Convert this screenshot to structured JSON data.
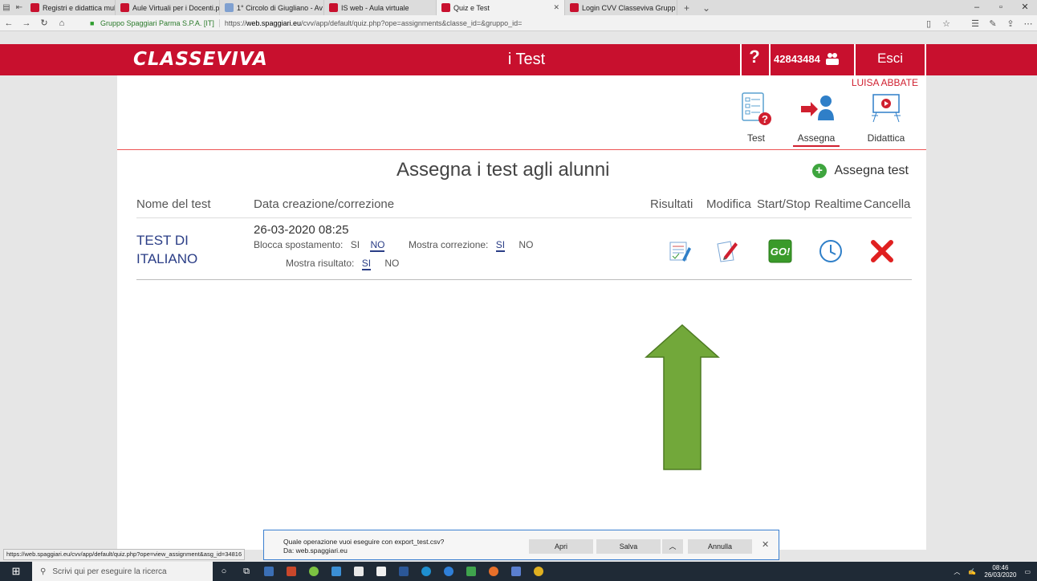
{
  "browser": {
    "tabs": [
      {
        "label": "Registri e didattica multime",
        "color": "#c8102e",
        "active": false
      },
      {
        "label": "Aule Virtuali per i Docenti.p",
        "color": "#c8102e",
        "active": false
      },
      {
        "label": "1° Circolo di Giugliano - Av",
        "color": "#7fa0d0",
        "active": false
      },
      {
        "label": "IS web - Aula virtuale",
        "color": "#c8102e",
        "active": false
      },
      {
        "label": "Quiz e Test",
        "color": "#c8102e",
        "active": true
      },
      {
        "label": "Login CVV Classeviva Grupp",
        "color": "#c8102e",
        "active": false
      }
    ],
    "address": {
      "site_name": "Gruppo Spaggiari Parma S.P.A. [IT]",
      "url_prefix": "https://",
      "url_host": "web.spaggiari.eu",
      "url_path": "/cvv/app/default/quiz.php?ope=assignments&classe_id=&gruppo_id="
    },
    "status_url": "https://web.spaggiari.eu/cvv/app/default/quiz.php?ope=view_assignment&asg_id=34816"
  },
  "header": {
    "logo": "CLASSEVIVA",
    "title": "i Test",
    "help": "?",
    "user_code": "42843484",
    "logout": "Esci",
    "user_name": "LUISA ABBATE"
  },
  "nav": {
    "items": [
      {
        "label": "Test",
        "icon": "test-checklist-icon",
        "active": false
      },
      {
        "label": "Assegna",
        "icon": "assign-user-icon",
        "active": true
      },
      {
        "label": "Didattica",
        "icon": "presentation-board-icon",
        "active": false
      }
    ]
  },
  "main": {
    "heading": "Assegna i test agli alunni",
    "add_button": "Assegna test",
    "columns": {
      "name": "Nome del test",
      "date": "Data creazione/correzione",
      "results": "Risultati",
      "edit": "Modifica",
      "startstop": "Start/Stop",
      "realtime": "Realtime",
      "delete": "Cancella"
    },
    "rows": [
      {
        "name_line1": "TEST DI",
        "name_line2": "ITALIANO",
        "date": "26-03-2020 08:25",
        "lock_label": "Blocca spostamento:",
        "lock_si": "SI",
        "lock_no": "NO",
        "correction_label": "Mostra correzione:",
        "correction_si": "SI",
        "correction_no": "NO",
        "result_label": "Mostra risultato:",
        "result_si": "SI",
        "result_no": "NO",
        "go_label": "GO!"
      }
    ]
  },
  "download": {
    "question": "Quale operazione vuoi eseguire con export_test.csv?",
    "from": "Da: web.spaggiari.eu",
    "open": "Apri",
    "save": "Salva",
    "cancel": "Annulla"
  },
  "taskbar": {
    "search_placeholder": "Scrivi qui per eseguire la ricerca",
    "time": "08:46",
    "date": "26/03/2020"
  },
  "colors": {
    "brand": "#c8102e",
    "accent_blue": "#2a3d86",
    "arrow_green": "#72a83a"
  }
}
